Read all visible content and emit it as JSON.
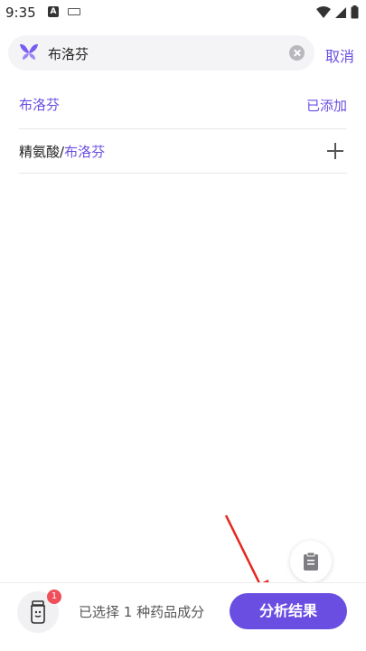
{
  "status_bar": {
    "time": "9:35",
    "icons": [
      "a-icon",
      "keyboard-icon",
      "wifi-icon",
      "signal-icon",
      "battery-icon"
    ]
  },
  "search": {
    "value": "布洛芬",
    "cancel_label": "取消"
  },
  "results": [
    {
      "name": "布洛芬",
      "status": "已添加"
    },
    {
      "prefix": "精氨酸/",
      "highlight": "布洛芬"
    }
  ],
  "bottom": {
    "badge_count": "1",
    "selected_text": "已选择 1 种药品成分",
    "analyze_label": "分析结果"
  },
  "colors": {
    "accent": "#6a4ee2",
    "badge": "#f04f5a",
    "arrow": "#e5261e"
  }
}
